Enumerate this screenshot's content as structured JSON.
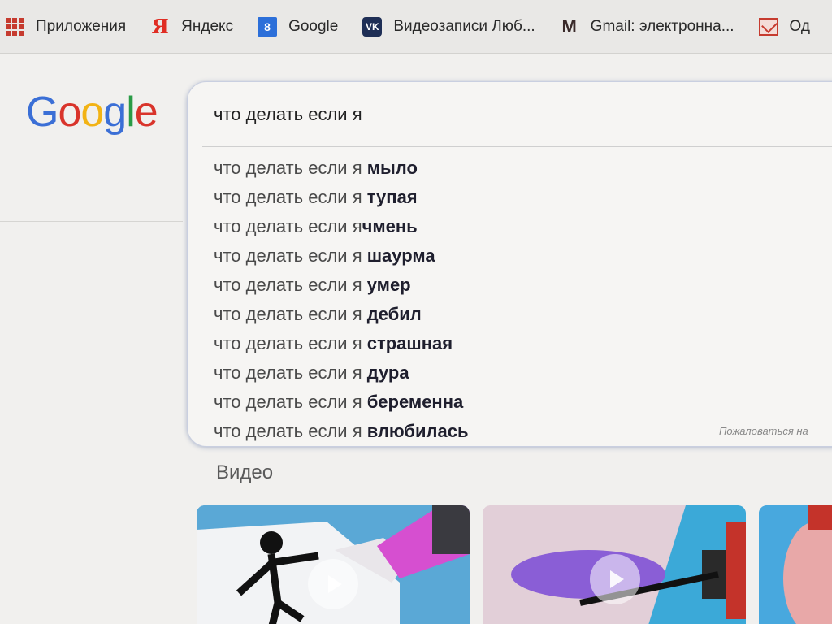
{
  "bookmarks": [
    {
      "label": "Приложения",
      "icon": "apps-grid-icon"
    },
    {
      "label": "Яндекс",
      "icon": "yandex-icon"
    },
    {
      "label": "Google",
      "icon": "google-bookmark-icon"
    },
    {
      "label": "Видеозаписи Люб...",
      "icon": "vk-icon"
    },
    {
      "label": "Gmail: электронна...",
      "icon": "gmail-icon"
    },
    {
      "label": "Од",
      "icon": "mail-icon"
    }
  ],
  "logo": {
    "letters": [
      "G",
      "o",
      "o",
      "g",
      "l",
      "e"
    ],
    "colors": [
      "#3b6fd6",
      "#d9342b",
      "#f2b315",
      "#3b6fd6",
      "#2a9b46",
      "#d9342b"
    ]
  },
  "search": {
    "value": "что делать если я"
  },
  "suggestions": [
    {
      "prefix": "что делать если я ",
      "bold": "мыло"
    },
    {
      "prefix": "что делать если я ",
      "bold": "тупая"
    },
    {
      "prefix": "что делать если я",
      "bold": "чмень"
    },
    {
      "prefix": "что делать если я ",
      "bold": "шаурма"
    },
    {
      "prefix": "что делать если я ",
      "bold": "умер"
    },
    {
      "prefix": "что делать если я ",
      "bold": "дебил"
    },
    {
      "prefix": "что делать если я ",
      "bold": "страшная"
    },
    {
      "prefix": "что делать если я ",
      "bold": "дура"
    },
    {
      "prefix": "что делать если я ",
      "bold": "беременна"
    },
    {
      "prefix": "что делать если я ",
      "bold": "влюбилась"
    }
  ],
  "report_link": "Пожаловаться на",
  "video_section": {
    "title": "Видео"
  }
}
